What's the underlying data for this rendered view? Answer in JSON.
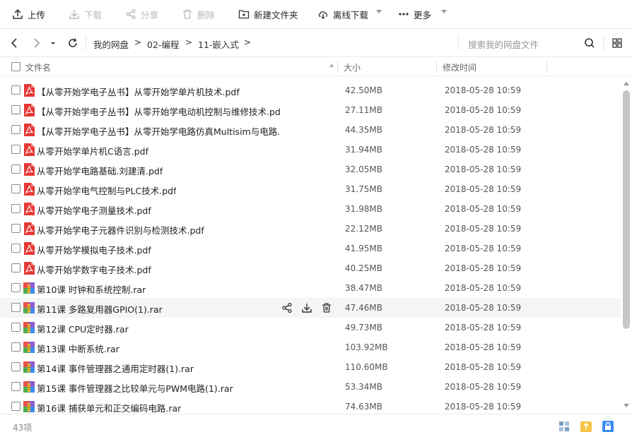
{
  "toolbar": {
    "upload": "上传",
    "download": "下载",
    "share": "分享",
    "delete": "删除",
    "new_folder": "新建文件夹",
    "offline_download": "离线下载",
    "more": "更多"
  },
  "nav": {
    "breadcrumb": [
      "我的网盘",
      "02-编程",
      "11-嵌入式"
    ],
    "separator": ">",
    "search_placeholder": "搜索我的网盘文件"
  },
  "columns": {
    "name": "文件名",
    "size": "大小",
    "modified": "修改时间"
  },
  "files": [
    {
      "name": "【从零开始学电子丛书】从零开始学单片机技术.pdf",
      "size": "42.50MB",
      "modified": "2018-05-28 10:59",
      "type": "pdf"
    },
    {
      "name": "【从零开始学电子丛书】从零开始学电动机控制与维修技术.pdf",
      "size": "27.11MB",
      "modified": "2018-05-28 10:59",
      "type": "pdf"
    },
    {
      "name": "【从零开始学电子丛书】从零开始学电路仿真Multisim与电路...",
      "size": "44.35MB",
      "modified": "2018-05-28 10:59",
      "type": "pdf"
    },
    {
      "name": "从零开始学单片机C语言.pdf",
      "size": "31.94MB",
      "modified": "2018-05-28 10:59",
      "type": "pdf"
    },
    {
      "name": "从零开始学电路基础.刘建清.pdf",
      "size": "32.05MB",
      "modified": "2018-05-28 10:59",
      "type": "pdf"
    },
    {
      "name": "从零开始学电气控制与PLC技术.pdf",
      "size": "31.75MB",
      "modified": "2018-05-28 10:59",
      "type": "pdf"
    },
    {
      "name": "从零开始学电子测量技术.pdf",
      "size": "31.98MB",
      "modified": "2018-05-28 10:59",
      "type": "pdf"
    },
    {
      "name": "从零开始学电子元器件识别与检测技术.pdf",
      "size": "22.12MB",
      "modified": "2018-05-28 10:59",
      "type": "pdf"
    },
    {
      "name": "从零开始学模拟电子技术.pdf",
      "size": "41.95MB",
      "modified": "2018-05-28 10:59",
      "type": "pdf"
    },
    {
      "name": "从零开始学数字电子技术.pdf",
      "size": "40.25MB",
      "modified": "2018-05-28 10:59",
      "type": "pdf"
    },
    {
      "name": "第10课 时钟和系统控制.rar",
      "size": "38.47MB",
      "modified": "2018-05-28 10:59",
      "type": "rar"
    },
    {
      "name": "第11课 多路复用器GPIO(1).rar",
      "size": "47.46MB",
      "modified": "2018-05-28 10:59",
      "type": "rar",
      "hover": true
    },
    {
      "name": "第12课 CPU定时器.rar",
      "size": "49.73MB",
      "modified": "2018-05-28 10:59",
      "type": "rar"
    },
    {
      "name": "第13课 中断系统.rar",
      "size": "103.92MB",
      "modified": "2018-05-28 10:59",
      "type": "rar"
    },
    {
      "name": "第14课 事件管理器之通用定时器(1).rar",
      "size": "110.60MB",
      "modified": "2018-05-28 10:59",
      "type": "rar"
    },
    {
      "name": "第15课 事件管理器之比较单元与PWM电路(1).rar",
      "size": "53.34MB",
      "modified": "2018-05-28 10:59",
      "type": "rar"
    },
    {
      "name": "第16课 捕获单元和正交编码电路.rar",
      "size": "74.63MB",
      "modified": "2018-05-28 10:59",
      "type": "rar"
    }
  ],
  "status": {
    "count": "43项"
  },
  "colors": {
    "pdf": "#e53935",
    "rar_purple": "#8e5bd1",
    "accent": "#3b8cf0"
  }
}
